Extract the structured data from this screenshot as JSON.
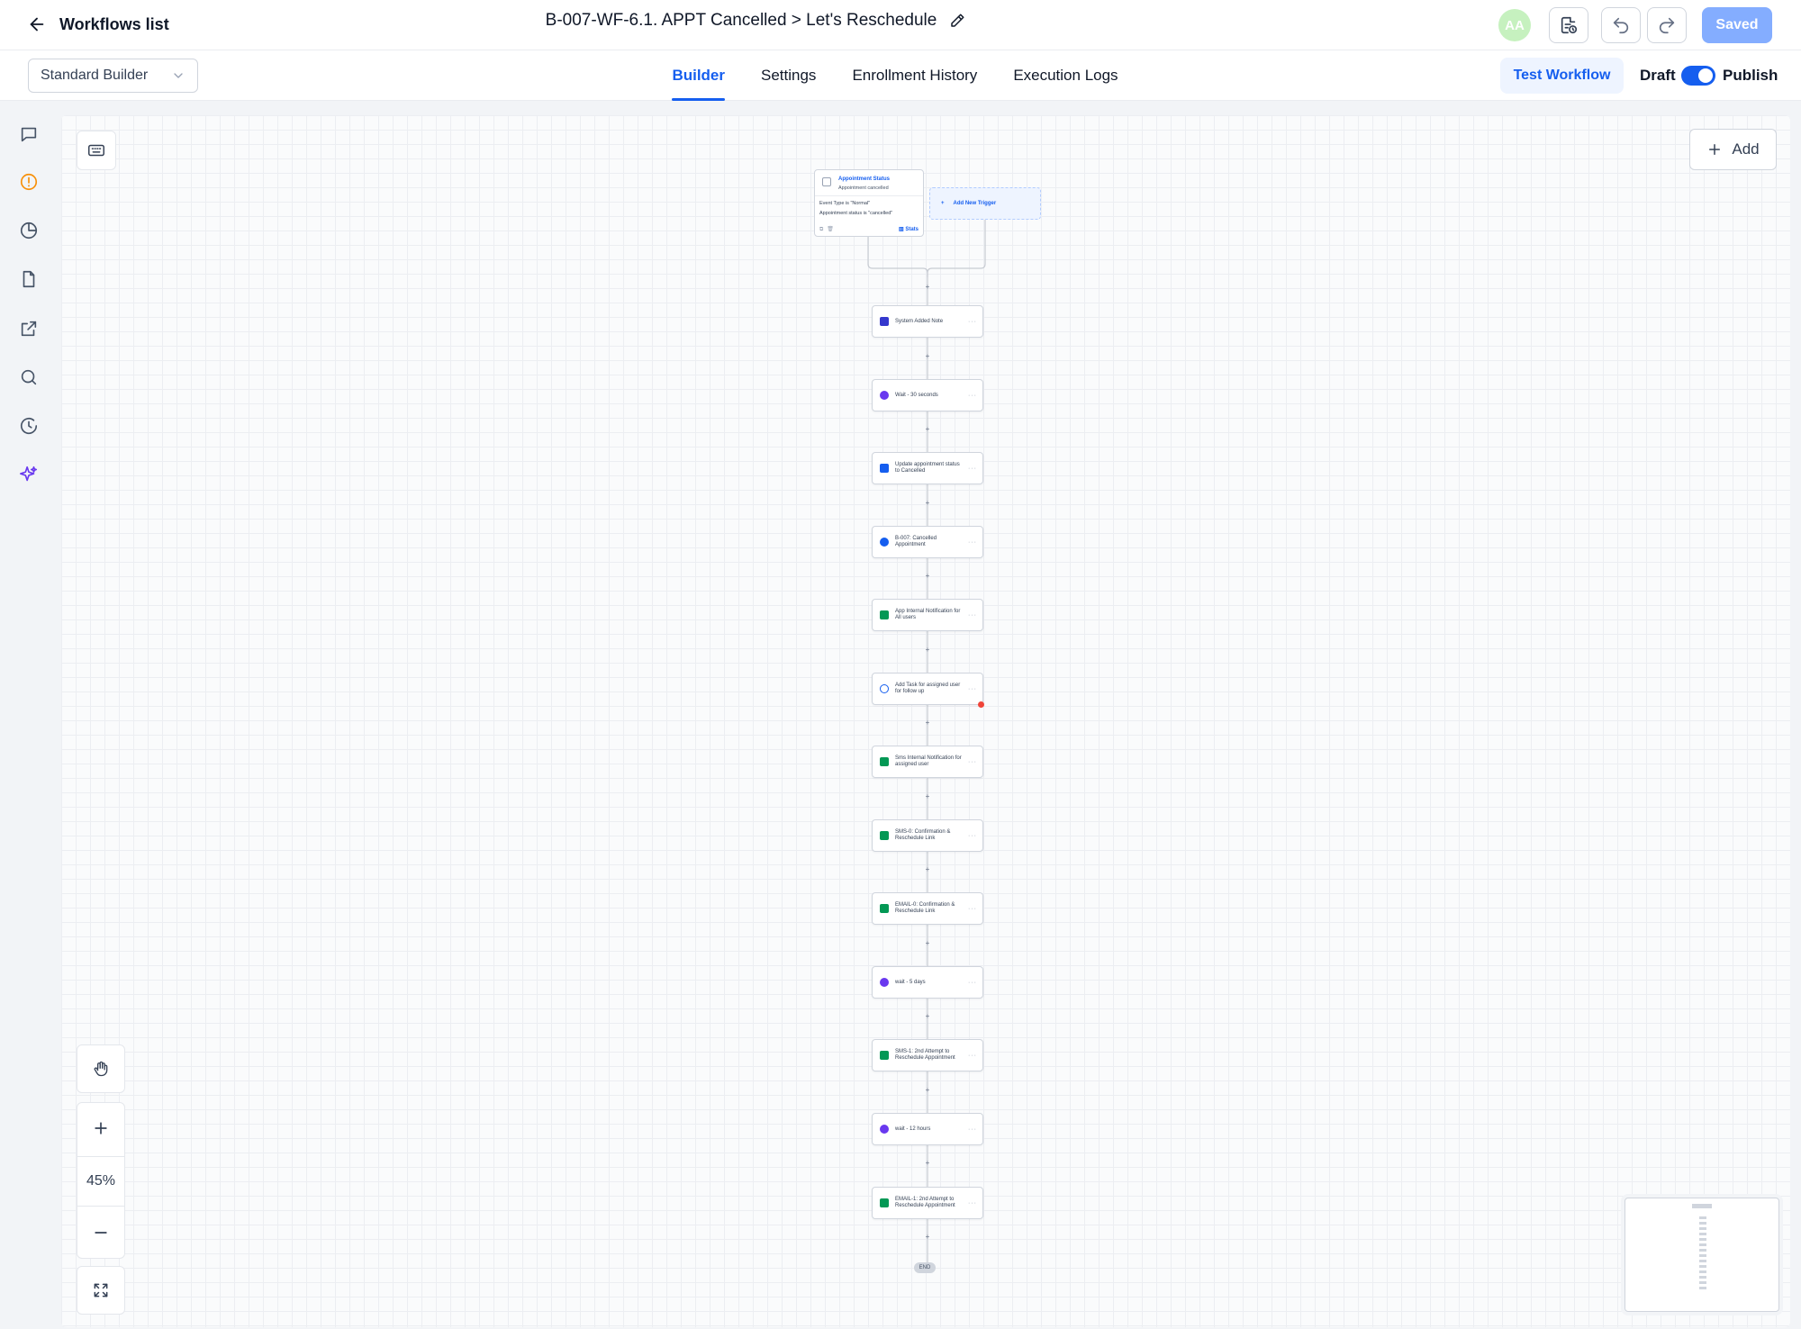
{
  "header": {
    "back_label": "Workflows list",
    "workflow_title": "B-007-WF-6.1. APPT Cancelled > Let's Reschedule",
    "avatar_initials": "AA",
    "saved_label": "Saved"
  },
  "subbar": {
    "builder_mode": "Standard Builder",
    "tabs": [
      {
        "label": "Builder",
        "active": true
      },
      {
        "label": "Settings",
        "active": false
      },
      {
        "label": "Enrollment History",
        "active": false
      },
      {
        "label": "Execution Logs",
        "active": false
      }
    ],
    "test_label": "Test Workflow",
    "draft_label": "Draft",
    "publish_label": "Publish",
    "publish_on": true
  },
  "rail": {
    "icons": [
      "chat-icon",
      "alert-circle-icon",
      "pie-chart-icon",
      "file-icon",
      "external-link-icon",
      "search-icon",
      "clock-history-icon",
      "sparkle-icon"
    ]
  },
  "canvas": {
    "add_label": "Add",
    "zoom_level": "45%",
    "trigger": {
      "title": "Appointment Status",
      "subtitle": "Appointment cancelled",
      "condition_1": "Event Type is \"Normal\"",
      "condition_2": "Appointment status is \"cancelled\"",
      "stats_label": "Stats"
    },
    "add_trigger_label": "Add New Trigger",
    "actions": [
      {
        "label": "System Added Note",
        "icon": "note-icon",
        "color": "#3538cd"
      },
      {
        "label": "Wait - 30 seconds",
        "icon": "clock-icon",
        "color": "#6938ef"
      },
      {
        "label": "Update appointment status to Cancelled",
        "icon": "calendar-icon",
        "color": "#155eef"
      },
      {
        "label": "B-007: Cancelled Appointment",
        "icon": "tag-icon",
        "color": "#155eef"
      },
      {
        "label": "App Internal Notification for All users",
        "icon": "bell-icon",
        "color": "#039855"
      },
      {
        "label": "Add Task for assigned user for follow up",
        "icon": "task-icon",
        "color": "#155eef"
      },
      {
        "label": "Sms Internal Notification for assigned user",
        "icon": "bell-icon",
        "color": "#039855"
      },
      {
        "label": "SMS-0: Confirmation & Reschedule Link",
        "icon": "sms-icon",
        "color": "#039855"
      },
      {
        "label": "EMAIL-0: Confirmation & Reschedule Link",
        "icon": "email-icon",
        "color": "#039855"
      },
      {
        "label": "wait - 5 days",
        "icon": "clock-icon",
        "color": "#6938ef"
      },
      {
        "label": "SMS-1: 2nd Attempt to Reschedule Appointment",
        "icon": "sms-icon",
        "color": "#039855"
      },
      {
        "label": "wait - 12 hours",
        "icon": "clock-icon",
        "color": "#6938ef"
      },
      {
        "label": "EMAIL-1: 2nd Attempt to Reschedule Appointment",
        "icon": "email-icon",
        "color": "#039855"
      }
    ],
    "end_label": "END"
  }
}
